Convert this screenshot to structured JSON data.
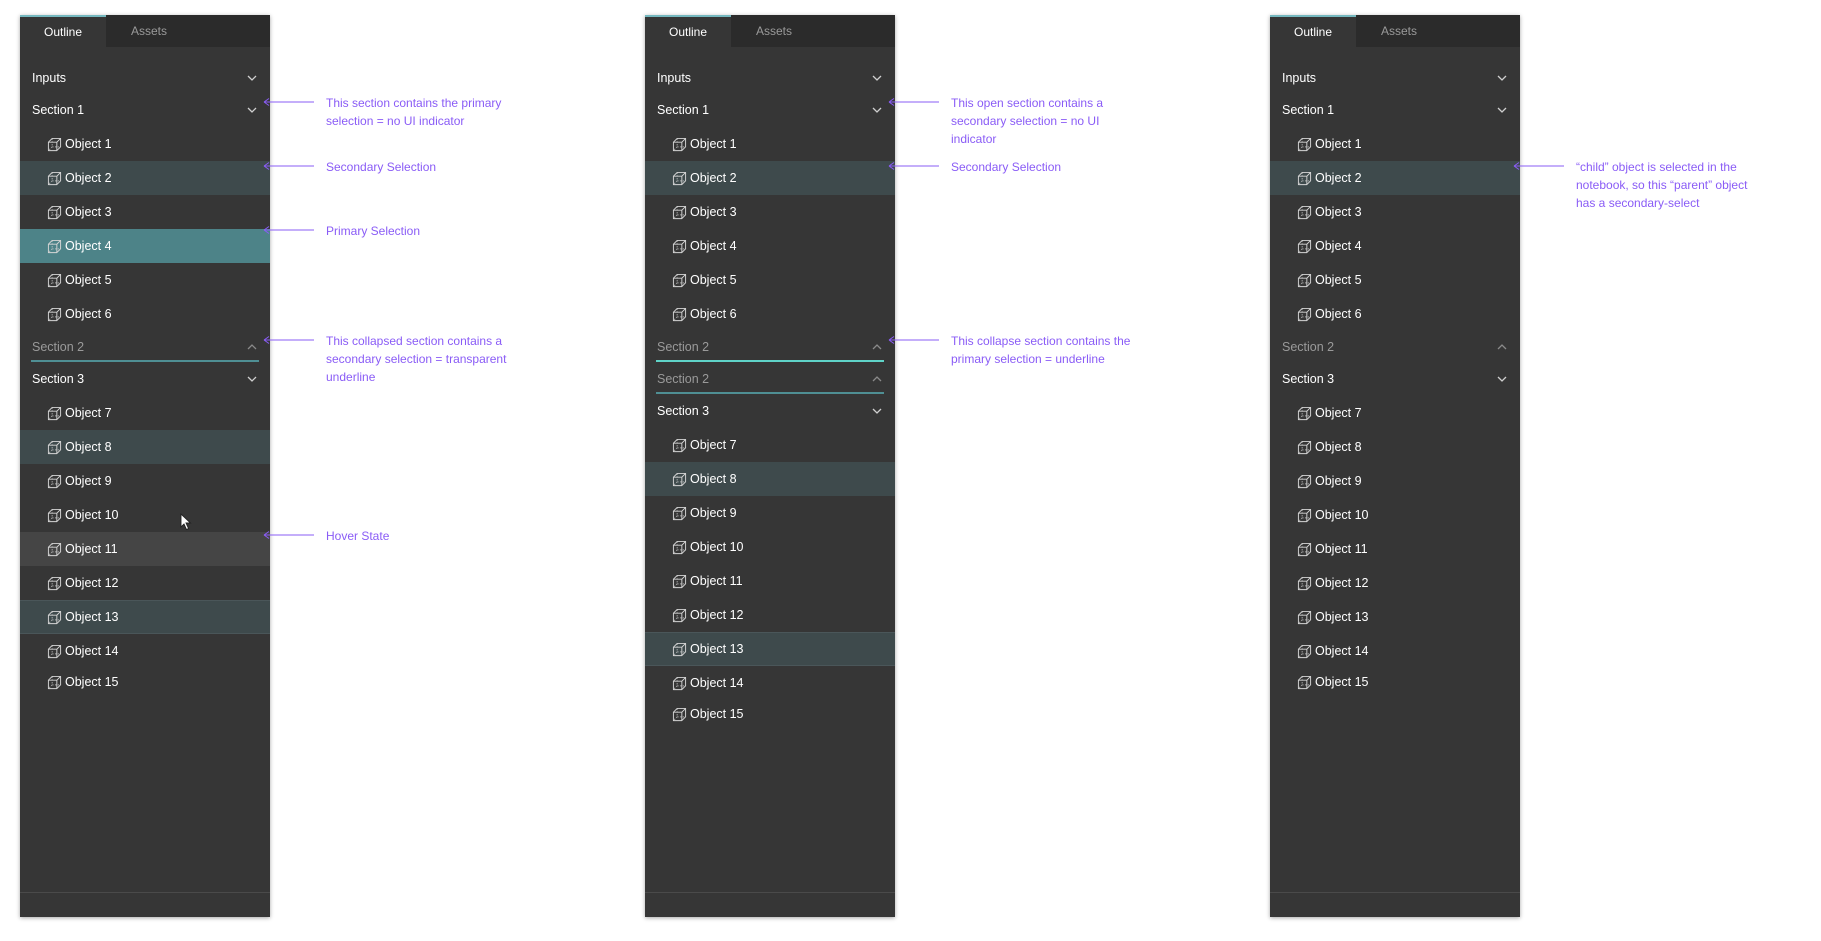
{
  "colors": {
    "panel_bg": "#363636",
    "tabbar_bg": "#2b2b2b",
    "secondary_selection": "#3e4a4c",
    "primary_selection": "#4d8388",
    "hover": "#454545",
    "underline_primary": "#5fd3c8",
    "underline_secondary": "#4f8f94",
    "annotation": "#8a5cf6"
  },
  "panels": [
    {
      "tabs": [
        {
          "label": "Outline",
          "active": true
        },
        {
          "label": "Assets",
          "active": false
        }
      ],
      "rows": [
        {
          "kind": "section",
          "label": "Inputs",
          "state": "open"
        },
        {
          "kind": "section",
          "label": "Section 1",
          "state": "open"
        },
        {
          "kind": "object",
          "label": "Object 1",
          "state": "none"
        },
        {
          "kind": "object",
          "label": "Object 2",
          "state": "secondary"
        },
        {
          "kind": "object",
          "label": "Object 3",
          "state": "none"
        },
        {
          "kind": "object",
          "label": "Object 4",
          "state": "primary"
        },
        {
          "kind": "object",
          "label": "Object 5",
          "state": "none"
        },
        {
          "kind": "object",
          "label": "Object 6",
          "state": "none"
        },
        {
          "kind": "section",
          "label": "Section 2",
          "state": "collapsed",
          "underline": "secondary"
        },
        {
          "kind": "section",
          "label": "Section 3",
          "state": "open"
        },
        {
          "kind": "object",
          "label": "Object 7",
          "state": "none"
        },
        {
          "kind": "object",
          "label": "Object 8",
          "state": "secondary"
        },
        {
          "kind": "object",
          "label": "Object 9",
          "state": "none"
        },
        {
          "kind": "object",
          "label": "Object 10",
          "state": "none"
        },
        {
          "kind": "object",
          "label": "Object 11",
          "state": "hover"
        },
        {
          "kind": "object",
          "label": "Object 12",
          "state": "none"
        },
        {
          "kind": "object",
          "label": "Object 13",
          "state": "secondary-edge"
        },
        {
          "kind": "object",
          "label": "Object 14",
          "state": "none"
        },
        {
          "kind": "object",
          "label": "Object 15",
          "state": "none"
        }
      ],
      "annotations": [
        "This section contains the primary selection = no UI indicator",
        "Secondary Selection",
        "Primary Selection",
        "This collapsed section contains a secondary selection = transparent underline",
        "Hover State"
      ]
    },
    {
      "tabs": [
        {
          "label": "Outline",
          "active": true
        },
        {
          "label": "Assets",
          "active": false
        }
      ],
      "rows": [
        {
          "kind": "section",
          "label": "Inputs",
          "state": "open"
        },
        {
          "kind": "section",
          "label": "Section 1",
          "state": "open"
        },
        {
          "kind": "object",
          "label": "Object 1",
          "state": "none"
        },
        {
          "kind": "object",
          "label": "Object 2",
          "state": "secondary"
        },
        {
          "kind": "object",
          "label": "Object 3",
          "state": "none"
        },
        {
          "kind": "object",
          "label": "Object 4",
          "state": "none"
        },
        {
          "kind": "object",
          "label": "Object 5",
          "state": "none"
        },
        {
          "kind": "object",
          "label": "Object 6",
          "state": "none"
        },
        {
          "kind": "section",
          "label": "Section 2",
          "state": "collapsed",
          "underline": "primary"
        },
        {
          "kind": "section",
          "label": "Section 2",
          "state": "collapsed",
          "underline": "secondary"
        },
        {
          "kind": "section",
          "label": "Section 3",
          "state": "open"
        },
        {
          "kind": "object",
          "label": "Object 7",
          "state": "none"
        },
        {
          "kind": "object",
          "label": "Object 8",
          "state": "secondary"
        },
        {
          "kind": "object",
          "label": "Object 9",
          "state": "none"
        },
        {
          "kind": "object",
          "label": "Object 10",
          "state": "none"
        },
        {
          "kind": "object",
          "label": "Object 11",
          "state": "none"
        },
        {
          "kind": "object",
          "label": "Object 12",
          "state": "none"
        },
        {
          "kind": "object",
          "label": "Object 13",
          "state": "secondary-edge"
        },
        {
          "kind": "object",
          "label": "Object 14",
          "state": "none"
        },
        {
          "kind": "object",
          "label": "Object 15",
          "state": "none"
        }
      ],
      "annotations": [
        "This open section contains a secondary selection = no UI indicator",
        "Secondary Selection",
        "This collapse section contains the primary selection = underline"
      ]
    },
    {
      "tabs": [
        {
          "label": "Outline",
          "active": true
        },
        {
          "label": "Assets",
          "active": false
        }
      ],
      "rows": [
        {
          "kind": "section",
          "label": "Inputs",
          "state": "open"
        },
        {
          "kind": "section",
          "label": "Section 1",
          "state": "open"
        },
        {
          "kind": "object",
          "label": "Object 1",
          "state": "none"
        },
        {
          "kind": "object",
          "label": "Object 2",
          "state": "secondary"
        },
        {
          "kind": "object",
          "label": "Object 3",
          "state": "none"
        },
        {
          "kind": "object",
          "label": "Object 4",
          "state": "none"
        },
        {
          "kind": "object",
          "label": "Object 5",
          "state": "none"
        },
        {
          "kind": "object",
          "label": "Object 6",
          "state": "none"
        },
        {
          "kind": "section",
          "label": "Section 2",
          "state": "collapsed",
          "underline": "none"
        },
        {
          "kind": "section",
          "label": "Section 3",
          "state": "open"
        },
        {
          "kind": "object",
          "label": "Object 7",
          "state": "none"
        },
        {
          "kind": "object",
          "label": "Object 8",
          "state": "none"
        },
        {
          "kind": "object",
          "label": "Object 9",
          "state": "none"
        },
        {
          "kind": "object",
          "label": "Object 10",
          "state": "none"
        },
        {
          "kind": "object",
          "label": "Object 11",
          "state": "none"
        },
        {
          "kind": "object",
          "label": "Object 12",
          "state": "none"
        },
        {
          "kind": "object",
          "label": "Object 13",
          "state": "none"
        },
        {
          "kind": "object",
          "label": "Object 14",
          "state": "none"
        },
        {
          "kind": "object",
          "label": "Object 15",
          "state": "none"
        }
      ],
      "annotations": [
        "“child” object is selected in the notebook, so this “parent” object has a secondary-select"
      ]
    }
  ],
  "icons": {
    "object": "cube-icon",
    "section_open": "chevron-down-icon",
    "section_collapsed": "chevron-up-icon",
    "annotation_arrow": "arrow-left-icon",
    "cursor": "mouse-pointer-icon"
  }
}
